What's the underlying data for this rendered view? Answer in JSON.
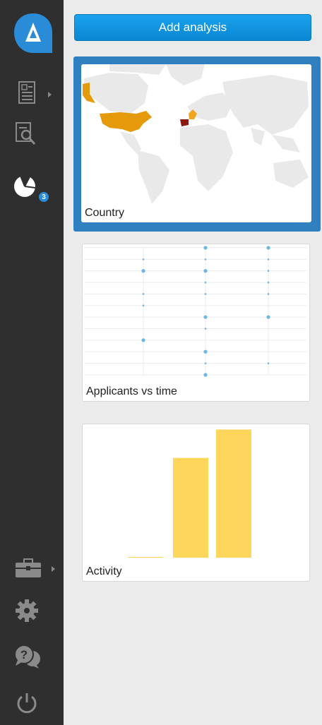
{
  "rail": {
    "logo": {
      "icon": "app-logo-icon",
      "color": "#2a8bd6"
    },
    "items": [
      {
        "name": "documents",
        "icon": "document-list-icon",
        "has_caret": true
      },
      {
        "name": "search-documents",
        "icon": "document-search-icon",
        "has_caret": false
      },
      {
        "name": "analytics",
        "icon": "pie-chart-icon",
        "has_caret": false,
        "badge": "3"
      }
    ],
    "bottom_items": [
      {
        "name": "toolbox",
        "icon": "briefcase-icon",
        "has_caret": true
      },
      {
        "name": "settings",
        "icon": "gear-icon",
        "has_caret": false
      },
      {
        "name": "help",
        "icon": "help-chat-icon",
        "has_caret": false
      },
      {
        "name": "power",
        "icon": "power-icon",
        "has_caret": false
      }
    ]
  },
  "main": {
    "add_button_label": "Add analysis",
    "cards": {
      "country": {
        "label": "Country",
        "selected": true
      },
      "applicants": {
        "label": "Applicants vs time"
      },
      "activity": {
        "label": "Activity"
      }
    }
  },
  "colors": {
    "accent": "#2a8bd6",
    "button": "#0a86d2",
    "selection": "#2f7fc1",
    "map_land": "#e9e9e9",
    "map_usa": "#e59a0c",
    "map_france": "#f0a61e",
    "map_spain": "#8b1a14",
    "scatter_point": "#6bb6ea",
    "bar": "#ffd65c"
  },
  "chart_data": [
    {
      "type": "scatter",
      "x_categories": [
        "1",
        "2",
        "3"
      ],
      "rows": 12,
      "points": [
        {
          "x": 1,
          "y": 1,
          "size": 1
        },
        {
          "x": 1,
          "y": 2,
          "size": 2
        },
        {
          "x": 1,
          "y": 4,
          "size": 1
        },
        {
          "x": 1,
          "y": 5,
          "size": 1
        },
        {
          "x": 1,
          "y": 8,
          "size": 2
        },
        {
          "x": 2,
          "y": 0,
          "size": 2
        },
        {
          "x": 2,
          "y": 1,
          "size": 1
        },
        {
          "x": 2,
          "y": 2,
          "size": 2
        },
        {
          "x": 2,
          "y": 3,
          "size": 1
        },
        {
          "x": 2,
          "y": 4,
          "size": 1
        },
        {
          "x": 2,
          "y": 6,
          "size": 2
        },
        {
          "x": 2,
          "y": 7,
          "size": 1
        },
        {
          "x": 2,
          "y": 9,
          "size": 2
        },
        {
          "x": 2,
          "y": 10,
          "size": 1
        },
        {
          "x": 2,
          "y": 11,
          "size": 2
        },
        {
          "x": 3,
          "y": 0,
          "size": 2
        },
        {
          "x": 3,
          "y": 1,
          "size": 1
        },
        {
          "x": 3,
          "y": 2,
          "size": 1
        },
        {
          "x": 3,
          "y": 3,
          "size": 1
        },
        {
          "x": 3,
          "y": 4,
          "size": 1
        },
        {
          "x": 3,
          "y": 6,
          "size": 2
        },
        {
          "x": 3,
          "y": 10,
          "size": 1
        }
      ],
      "grid": true
    },
    {
      "type": "bar",
      "categories": [
        "1",
        "2",
        "3"
      ],
      "values": [
        0.6,
        95,
        122
      ],
      "ylim": [
        0,
        125
      ]
    }
  ]
}
